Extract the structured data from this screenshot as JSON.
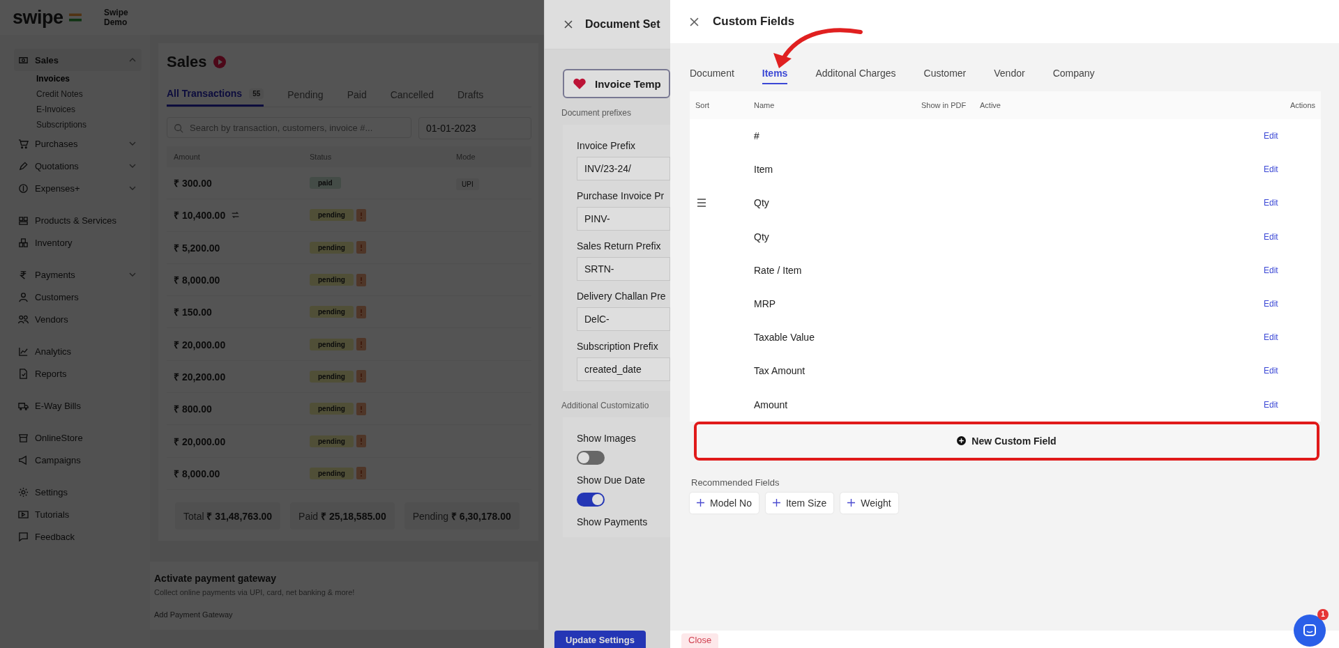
{
  "brand": {
    "logo": "swipe",
    "business": "Swipe Demo"
  },
  "sidebar": {
    "groups": [
      [
        {
          "label": "Sales",
          "selected": true,
          "expanded": true,
          "children": [
            {
              "label": "Invoices",
              "selected": true
            },
            {
              "label": "Credit Notes",
              "selected": false
            },
            {
              "label": "E-Invoices",
              "selected": false
            },
            {
              "label": "Subscriptions",
              "selected": false
            }
          ]
        },
        {
          "label": "Purchases",
          "expanded": false
        },
        {
          "label": "Quotations",
          "expanded": false
        },
        {
          "label": "Expenses+",
          "expanded": false
        }
      ],
      [
        {
          "label": "Products & Services"
        },
        {
          "label": "Inventory"
        }
      ],
      [
        {
          "label": "Payments",
          "expanded": false
        },
        {
          "label": "Customers"
        },
        {
          "label": "Vendors"
        }
      ],
      [
        {
          "label": "Analytics"
        },
        {
          "label": "Reports"
        }
      ],
      [
        {
          "label": "E-Way Bills"
        }
      ],
      [
        {
          "label": "OnlineStore"
        },
        {
          "label": "Campaigns"
        }
      ],
      [
        {
          "label": "Settings"
        },
        {
          "label": "Tutorials"
        },
        {
          "label": "Feedback"
        }
      ]
    ]
  },
  "sales": {
    "title": "Sales",
    "tabs": [
      {
        "label": "All Transactions",
        "count": "55",
        "selected": true
      },
      {
        "label": "Pending",
        "selected": false
      },
      {
        "label": "Paid",
        "selected": false
      },
      {
        "label": "Cancelled",
        "selected": false
      },
      {
        "label": "Drafts",
        "selected": false
      }
    ],
    "search": {
      "placeholder": "Search by transaction, customers, invoice #..."
    },
    "date": "01-01-2023",
    "columns": [
      "Amount",
      "Status",
      "Mode"
    ],
    "rows": [
      {
        "amount": "₹ 300.00",
        "status": "paid",
        "kind": "paid",
        "mode": "UPI",
        "recurring": false
      },
      {
        "amount": "₹ 10,400.00",
        "status": "pending",
        "kind": "pending",
        "recurring": true
      },
      {
        "amount": "₹ 5,200.00",
        "status": "pending",
        "kind": "pending",
        "recurring": false
      },
      {
        "amount": "₹ 8,000.00",
        "status": "pending",
        "kind": "pending",
        "recurring": false
      },
      {
        "amount": "₹ 150.00",
        "status": "pending",
        "kind": "pending",
        "recurring": false
      },
      {
        "amount": "₹ 20,000.00",
        "status": "pending",
        "kind": "pending",
        "recurring": false
      },
      {
        "amount": "₹ 20,200.00",
        "status": "pending",
        "kind": "pending",
        "recurring": false
      },
      {
        "amount": "₹ 800.00",
        "status": "pending",
        "kind": "pending",
        "recurring": false
      },
      {
        "amount": "₹ 20,000.00",
        "status": "pending",
        "kind": "pending",
        "recurring": false
      },
      {
        "amount": "₹ 8,000.00",
        "status": "pending",
        "kind": "pending",
        "recurring": false
      }
    ],
    "totals": [
      {
        "label": "Total",
        "value": "₹ 31,48,763.00"
      },
      {
        "label": "Paid",
        "value": "₹ 25,18,585.00"
      },
      {
        "label": "Pending",
        "value": "₹ 6,30,178.00"
      }
    ],
    "gateway": {
      "title": "Activate payment gateway",
      "text": "Collect online payments via UPI, card, net banking & more!",
      "link": "Add Payment Gateway"
    }
  },
  "document_settings": {
    "title": "Document Set",
    "template_button": "Invoice Temp",
    "prefix_section": "Document prefixes",
    "prefixes": [
      {
        "label": "Invoice Prefix",
        "value": "INV/23-24/"
      },
      {
        "label": "Purchase Invoice Pr",
        "value": "PINV-"
      },
      {
        "label": "Sales Return Prefix",
        "value": "SRTN-"
      },
      {
        "label": "Delivery Challan Pre",
        "value": "DelC-"
      },
      {
        "label": "Subscription Prefix",
        "value": "created_date"
      }
    ],
    "custom_section": "Additional Customizatio",
    "toggles": [
      {
        "label": "Show Images",
        "on": false
      },
      {
        "label": "Show Due Date",
        "on": true
      },
      {
        "label": "Show Payments"
      }
    ],
    "update_button": "Update Settings"
  },
  "custom_fields": {
    "title": "Custom Fields",
    "tabs": [
      {
        "label": "Document",
        "selected": false
      },
      {
        "label": "Items",
        "selected": true
      },
      {
        "label": "Additonal Charges",
        "selected": false
      },
      {
        "label": "Customer",
        "selected": false
      },
      {
        "label": "Vendor",
        "selected": false
      },
      {
        "label": "Company",
        "selected": false
      }
    ],
    "columns": [
      "Sort",
      "Name",
      "Show in PDF",
      "Active",
      "Actions"
    ],
    "rows": [
      {
        "name": "#",
        "action": "Edit",
        "hovered": false
      },
      {
        "name": "Item",
        "action": "Edit",
        "hovered": false
      },
      {
        "name": "Qty",
        "action": "Edit",
        "hovered": true
      },
      {
        "name": "Qty",
        "action": "Edit",
        "hovered": false
      },
      {
        "name": "Rate / Item",
        "action": "Edit",
        "hovered": false
      },
      {
        "name": "MRP",
        "action": "Edit",
        "hovered": false
      },
      {
        "name": "Taxable Value",
        "action": "Edit",
        "hovered": false
      },
      {
        "name": "Tax Amount",
        "action": "Edit",
        "hovered": false
      },
      {
        "name": "Amount",
        "action": "Edit",
        "hovered": false
      }
    ],
    "new_button": "New Custom Field",
    "recommended_title": "Recommended Fields",
    "recommended": [
      "Model No",
      "Item Size",
      "Weight"
    ],
    "close_button": "Close"
  },
  "chat": {
    "badge": "1"
  }
}
